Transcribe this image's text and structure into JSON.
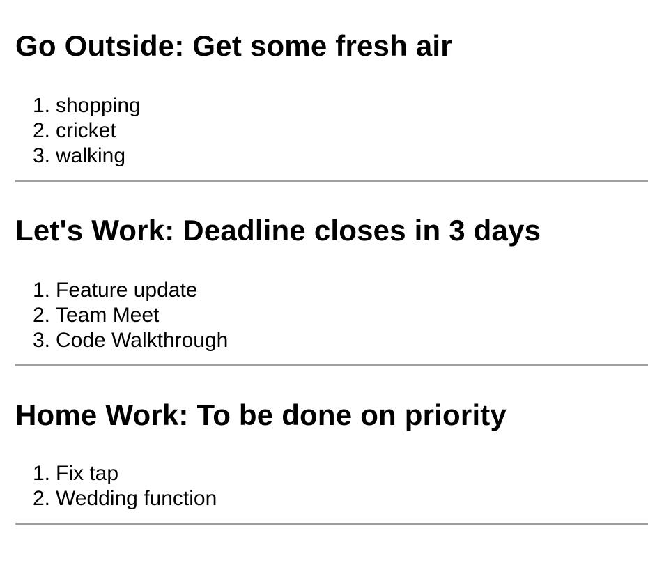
{
  "sections": [
    {
      "title": "Go Outside: Get some fresh air",
      "items": [
        "shopping",
        "cricket",
        "walking"
      ]
    },
    {
      "title": "Let's Work: Deadline closes in 3 days",
      "items": [
        "Feature update",
        "Team Meet",
        "Code Walkthrough"
      ]
    },
    {
      "title": "Home Work: To be done on priority",
      "items": [
        "Fix tap",
        "Wedding function"
      ]
    }
  ],
  "numbers": [
    "1.",
    "2.",
    "3."
  ]
}
